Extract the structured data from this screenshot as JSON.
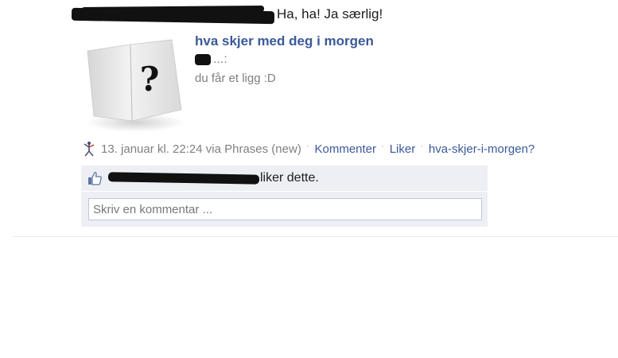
{
  "story": {
    "status_message": "Ha, ha! Ja særlig!",
    "attachment": {
      "title": "hva skjer med deg i morgen",
      "caption": "...:",
      "description": "du får et ligg :D",
      "image_icon": "question-mark-card-image"
    },
    "meta": {
      "app_icon": "phrases-app-icon",
      "timestamp": "13. januar kl. 22:24 via",
      "app_name": "Phrases (new)",
      "comment_label": "Kommenter",
      "like_label": "Liker",
      "app_tag": "hva-skjer-i-morgen?"
    },
    "feedback": {
      "like_icon": "thumbs-up-icon",
      "likes_text": "liker dette.",
      "comment_placeholder": "Skriv en kommentar ..."
    }
  },
  "colors": {
    "link": "#3b5998",
    "muted": "#808080",
    "feedback_bg": "#edeff4",
    "input_border": "#bdc7d8"
  }
}
